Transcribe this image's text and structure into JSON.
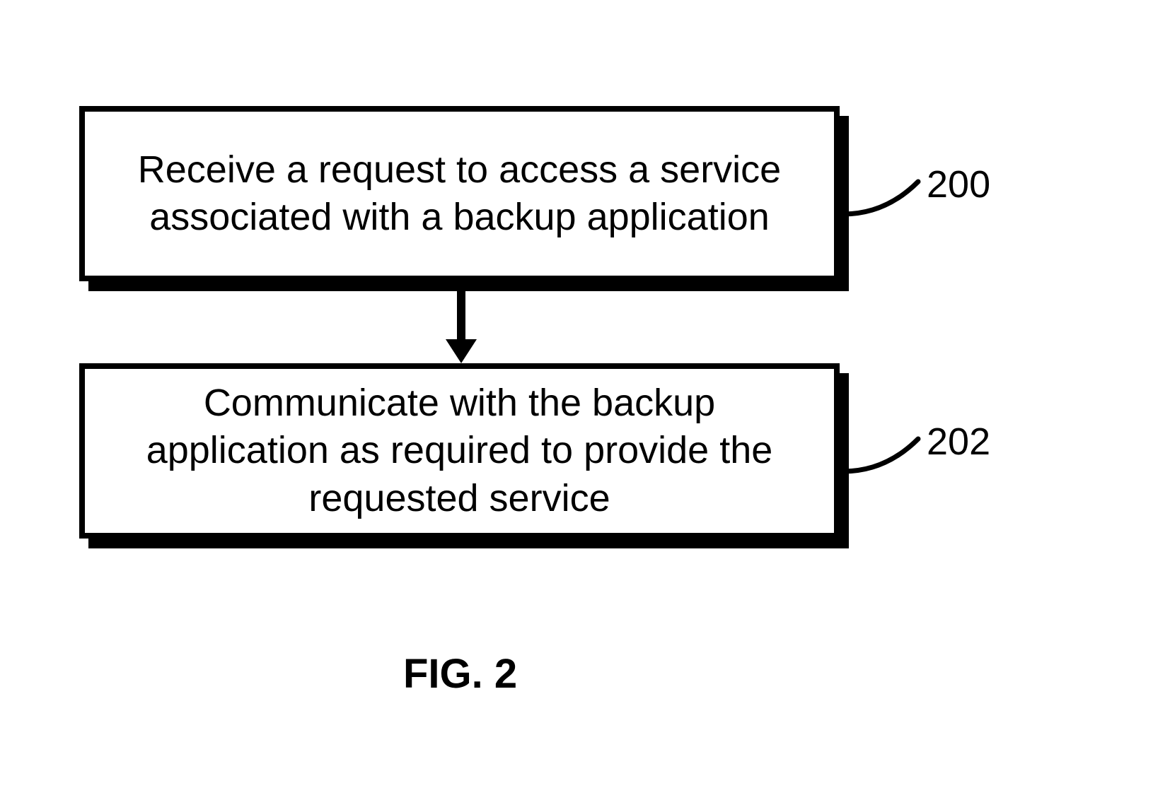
{
  "boxes": {
    "b1": {
      "text": "Receive a request to access a service associated with a backup application",
      "label": "200"
    },
    "b2": {
      "text": "Communicate with the backup application as required to provide the requested service",
      "label": "202"
    }
  },
  "caption": "FIG. 2"
}
